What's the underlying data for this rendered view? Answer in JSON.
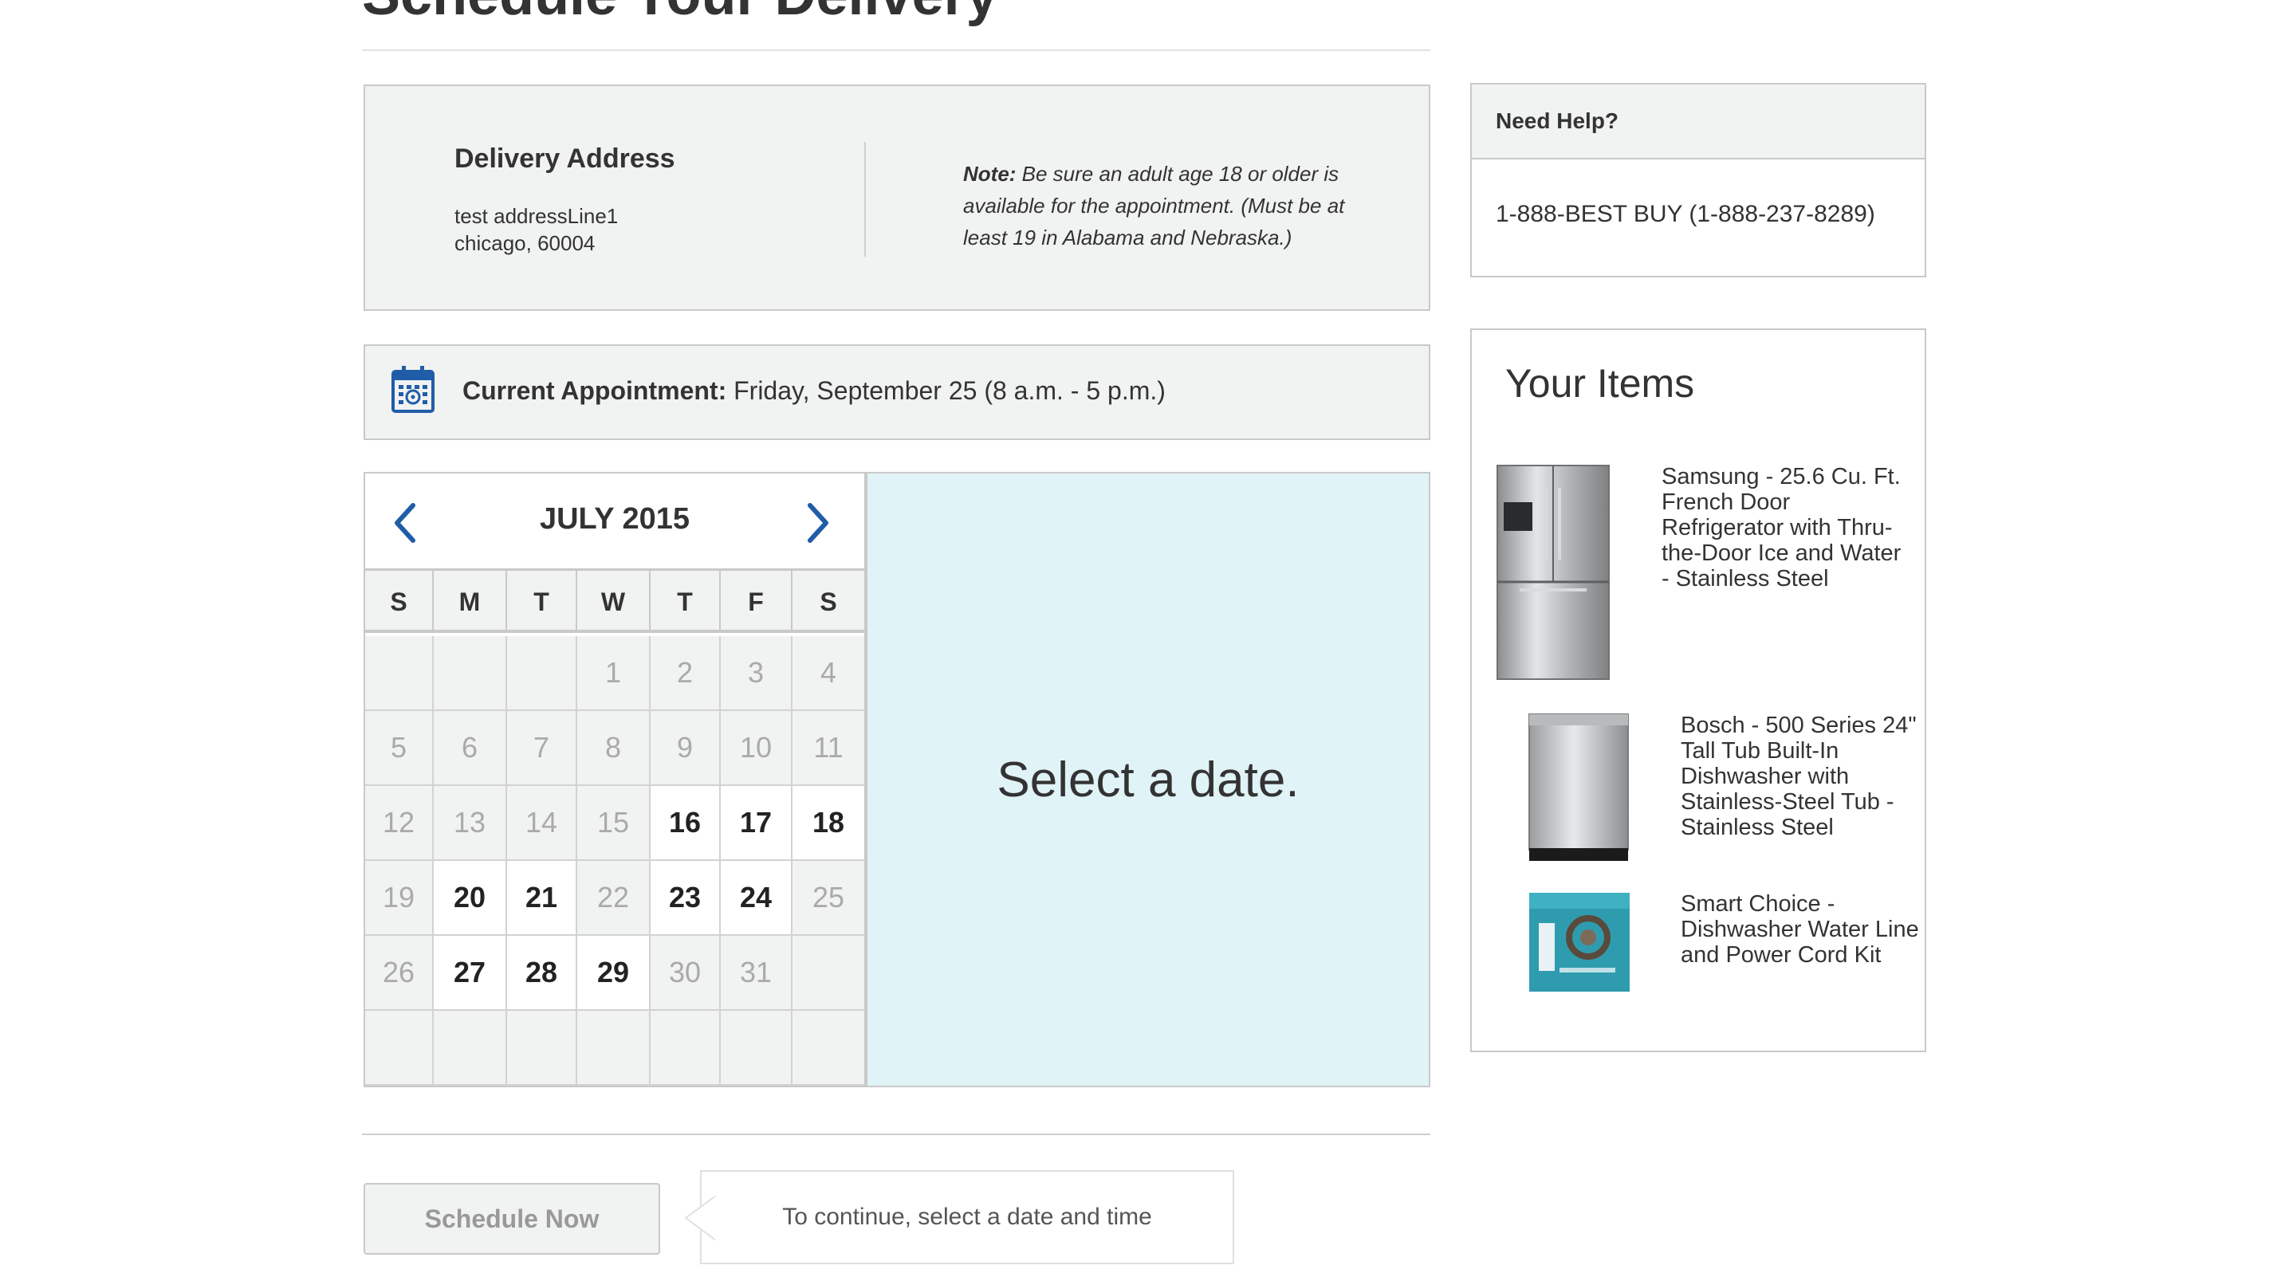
{
  "page": {
    "title": "Schedule Your Delivery"
  },
  "address": {
    "heading": "Delivery Address",
    "line1": "test addressLine1",
    "line2": "chicago, 60004",
    "note_label": "Note:",
    "note_text": " Be sure an adult age 18 or older is available for the appointment. (Must be at least 19 in Alabama and Nebraska.)"
  },
  "appointment": {
    "label": "Current Appointment:",
    "value": " Friday, September 25 (8 a.m. - 5 p.m.)",
    "icon": "calendar-icon"
  },
  "calendar": {
    "month": "JULY 2015",
    "prev_icon": "chevron-left-icon",
    "next_icon": "chevron-right-icon",
    "weekdays": [
      "S",
      "M",
      "T",
      "W",
      "T",
      "F",
      "S"
    ],
    "weeks": [
      [
        "",
        "",
        "",
        "1",
        "2",
        "3",
        "4"
      ],
      [
        "5",
        "6",
        "7",
        "8",
        "9",
        "10",
        "11"
      ],
      [
        "12",
        "13",
        "14",
        "15",
        "16",
        "17",
        "18"
      ],
      [
        "19",
        "20",
        "21",
        "22",
        "23",
        "24",
        "25"
      ],
      [
        "26",
        "27",
        "28",
        "29",
        "30",
        "31",
        ""
      ],
      [
        "",
        "",
        "",
        "",
        "",
        "",
        ""
      ]
    ],
    "available_days": [
      "16",
      "17",
      "18",
      "20",
      "21",
      "23",
      "24",
      "27",
      "28",
      "29"
    ]
  },
  "selection": {
    "prompt": "Select a date."
  },
  "actions": {
    "schedule_label": "Schedule Now",
    "hint": "To continue, select a date and time"
  },
  "help": {
    "title": "Need Help?",
    "phone": "1-888-BEST BUY (1-888-237-8289)"
  },
  "items": {
    "title": "Your Items",
    "list": [
      {
        "name": "Samsung - 25.6 Cu. Ft. French Door Refrigerator with Thru-the-Door Ice and Water - Stainless Steel"
      },
      {
        "name": "Bosch - 500 Series 24\" Tall Tub Built-In Dishwasher with Stainless-Steel Tub - Stainless Steel"
      },
      {
        "name": "Smart Choice - Dishwasher Water Line and Power Cord Kit"
      }
    ]
  },
  "colors": {
    "accent_blue": "#1f5da8",
    "panel_gray": "#f1f2f2",
    "select_panel": "#e0f3f6",
    "border": "#c9c9c9"
  }
}
